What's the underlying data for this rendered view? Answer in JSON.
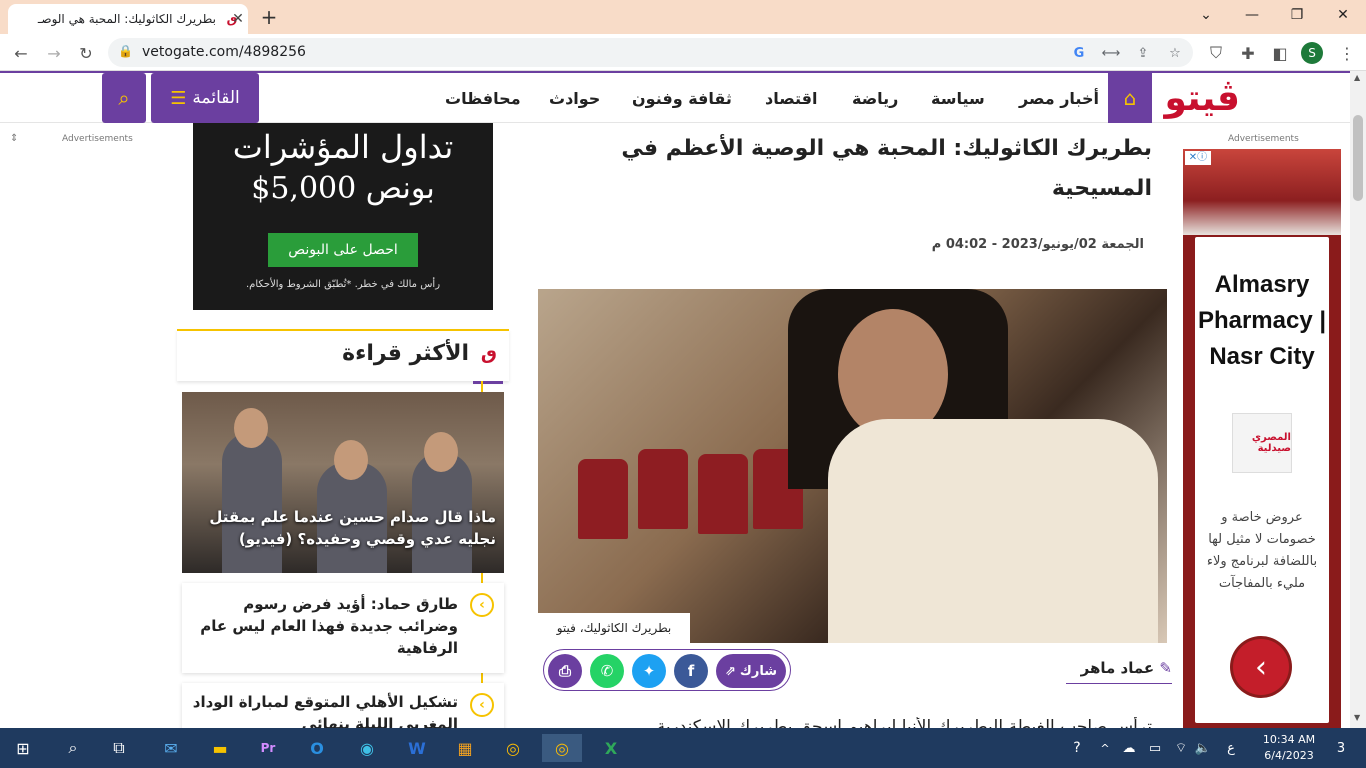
{
  "browser": {
    "tab_title": "بطريرك الكاثوليك: المحبة هي الوصـ",
    "url": "vetogate.com/4898256",
    "profile_initial": "S"
  },
  "site": {
    "logo_text": "ڤيتو",
    "nav_items": [
      "أخبار مصر",
      "سياسة",
      "رياضة",
      "اقتصاد",
      "ثقافة وفنون",
      "حوادث",
      "محافظات"
    ],
    "menu_label": "القائمة",
    "accent_color": "#6b3fa0",
    "accent2_color": "#f6c300"
  },
  "article": {
    "title": "بطريرك الكاثوليك: المحبة هي الوصية الأعظم في المسيحية",
    "date": "الجمعة 02/يونيو/2023 - 04:02 م",
    "image_caption": "بطريرك الكاثوليك، فيتو",
    "author": "عماد ماهر",
    "share_label": "شارك",
    "body_start": "ترأس صاحب الغبطة البطريرك الأنبا إبراهيم إسحق بطريرك الإسكندرية"
  },
  "ads": {
    "label": "Advertisements",
    "trade": {
      "headline": "تداول المؤشرات",
      "bonus": "بونص 5,000$",
      "button": "احصل على البونص",
      "disclaimer": "رأس مالك في خطر. *تُطبّق الشروط والأحكام."
    },
    "pharmacy": {
      "title": "Almasry Pharmacy | Nasr City",
      "logo_text": "المصري صيدلية",
      "text": "عروض خاصة و خصومات لا مثيل لها باللضافة لبرنامج ولاء مليء بالمفاجآت"
    }
  },
  "most_read": {
    "title": "الأكثر قراءة",
    "featured": "ماذا قال صدام حسين عندما علم بمقتل نجليه عدي وقصي وحفيده؟ (فيديو)",
    "items": [
      "طارق حماد: أؤيد فرض رسوم وضرائب جديدة فهذا العام ليس عام الرفاهية",
      "تشكيل الأهلي المتوقع لمباراة الوداد المغربي الليلة بنهائي"
    ]
  },
  "taskbar": {
    "time": "10:34 AM",
    "date": "6/4/2023",
    "lang": "ع",
    "notif_count": "3"
  }
}
